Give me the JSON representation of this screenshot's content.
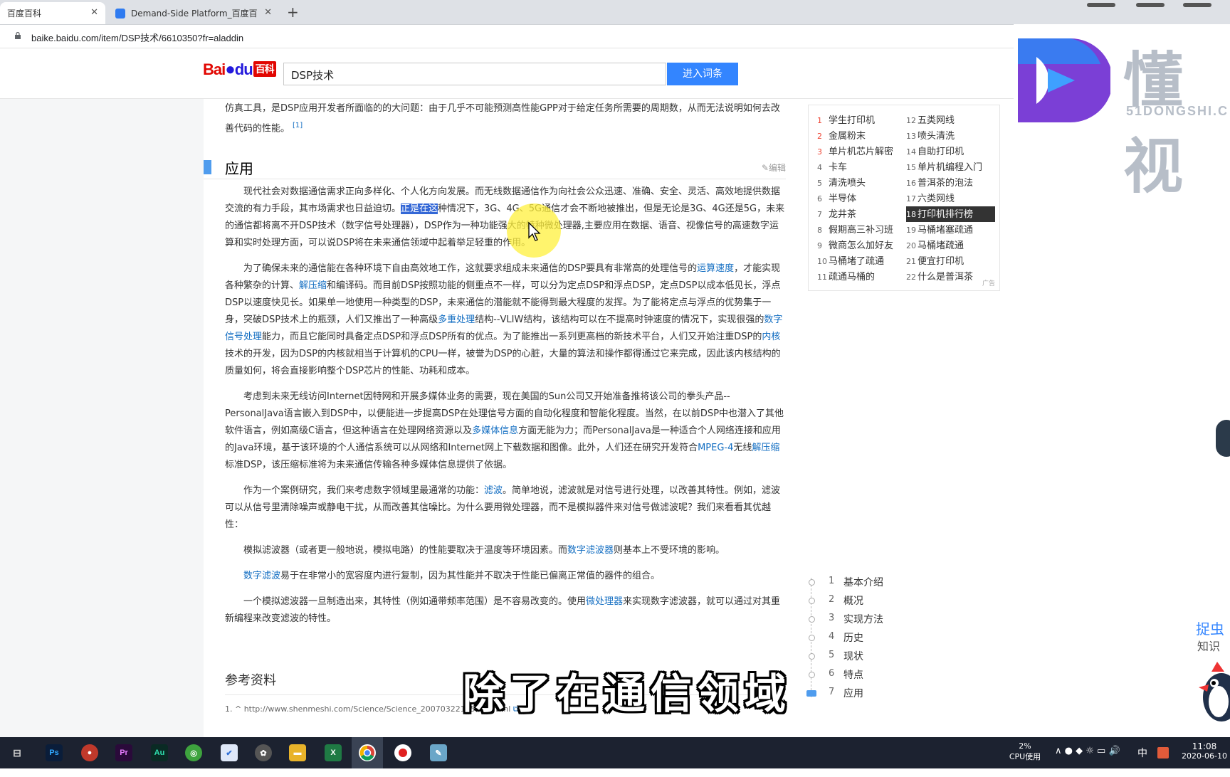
{
  "browser": {
    "tabs": [
      {
        "title": "百度百科",
        "active": true
      },
      {
        "title": "Demand-Side Platform_百度百",
        "active": false
      }
    ],
    "new_tab": "+",
    "url": "baike.baidu.com/item/DSP技术/6610350?fr=aladdin"
  },
  "header": {
    "logo_bai": "Bai",
    "logo_du": "du",
    "logo_baike": "百科",
    "search_value": "DSP技术",
    "search_button": "进入词条"
  },
  "article": {
    "intro": "仿真工具，是DSP应用开发者所面临的的大问题：由于几乎不可能预测高性能GPP对于给定任务所需要的周期数，从而无法说明如何去改善代码的性能。",
    "intro_ref": "[1]",
    "section_title": "应用",
    "edit_label": "编辑",
    "p1": {
      "a": "现代社会对数据通信需求正向多样化、个人化方向发展。而无线数据通信作为向社会公众迅速、准确、安全、灵活、高效地提供数据交流的有力手段，其市场需求也日益迫切。",
      "sel": "正是在这",
      "b": "种情况下，3G、4G、5G通信才会不断地被推出，但是无论是3G、4G还是5G，未来的通信都将离不开DSP技术（数字信号处理器），DSP作为一种功能强大的特种微处理器,主要应用在数据、语音、视像信号的高速数字运算和实时处理方面，可以说DSP将在未来通信领域中起着举足轻重的作用。"
    },
    "p2": {
      "a": "为了确保未来的通信能在各种环境下自由高效地工作，这就要求组成未来通信的DSP要具有非常高的处理信号的",
      "l1": "运算速度",
      "b": "，才能实现各种繁杂的计算、",
      "l2": "解压缩",
      "c": "和编译码。而目前DSP按照功能的侧重点不一样，可以分为定点DSP和浮点DSP，定点DSP以成本低见长，浮点DSP以速度快见长。如果单一地使用一种类型的DSP，未来通信的潜能就不能得到最大程度的发挥。为了能将定点与浮点的优势集于一身，突破DSP技术上的瓶颈，人们又推出了一种高级",
      "l3": "多重处理",
      "d": "结构--VLIW结构，该结构可以在不提高时钟速度的情况下，实现很强的",
      "l4": "数字信号处理",
      "e": "能力，而且它能同时具备定点DSP和浮点DSP所有的优点。为了能推出一系列更高档的新技术平台，人们又开始注重DSP的",
      "l5": "内核",
      "f": "技术的开发，因为DSP的内核就相当于计算机的CPU一样，被誉为DSP的心脏，大量的算法和操作都得通过它来完成，因此该内核结构的质量如何，将会直接影响整个DSP芯片的性能、功耗和成本。"
    },
    "p3": {
      "a": "考虑到未来无线访问Internet因特网和开展多媒体业务的需要，现在美国的Sun公司又开始准备推将该公司的拳头产品--PersonalJava语言嵌入到DSP中，以便能进一步提高DSP在处理信号方面的自动化程度和智能化程度。当然，在以前DSP中也潜入了其他软件语言，例如高级C语言，但这种语言在处理网络资源以及",
      "l1": "多媒体信息",
      "b": "方面无能为力；而PersonalJava是一种适合个人网络连接和应用的Java环境，基于该环境的个人通信系统可以从网络和Internet网上下载数据和图像。此外，人们还在研究开发符合",
      "l2": "MPEG-4",
      "c": "无线",
      "l3": "解压缩",
      "d": "标准DSP，该压缩标准将为未来通信传输各种多媒体信息提供了依据。"
    },
    "p4": {
      "a": "作为一个案例研究，我们来考虑数字领域里最通常的功能：",
      "l1": "滤波",
      "b": "。简单地说，滤波就是对信号进行处理，以改善其特性。例如，滤波可以从信号里清除噪声或静电干扰，从而改善其信噪比。为什么要用微处理器，而不是模拟器件来对信号做滤波呢？我们来看看其优越性："
    },
    "p5": {
      "a": "模拟滤波器（或者更一般地说，模拟电路）的性能要取决于温度等环境因素。而",
      "l1": "数字滤波器",
      "b": "则基本上不受环境的影响。"
    },
    "p6": {
      "l1": "数字滤波",
      "a": "易于在非常小的宽容度内进行复制，因为其性能并不取决于性能已偏离正常值的器件的组合。"
    },
    "p7": {
      "a": "一个模拟滤波器一旦制造出来，其特性（例如通带频率范围）是不容易改变的。使用",
      "l1": "微处理器",
      "b": "来实现数字滤波器，就可以通过对其重新编程来改变滤波的特性。"
    },
    "refs_title": "参考资料",
    "ref1": "1. ^ http://www.shenmeshi.com/Science/Science_20070322165927.html"
  },
  "hot_list": {
    "left": [
      {
        "n": "1",
        "t": "学生打印机"
      },
      {
        "n": "2",
        "t": "金属粉末"
      },
      {
        "n": "3",
        "t": "单片机芯片解密"
      },
      {
        "n": "4",
        "t": "卡车"
      },
      {
        "n": "5",
        "t": "清洗喷头"
      },
      {
        "n": "6",
        "t": "半导体"
      },
      {
        "n": "7",
        "t": "龙井茶"
      },
      {
        "n": "8",
        "t": "假期高三补习班"
      },
      {
        "n": "9",
        "t": "微商怎么加好友"
      },
      {
        "n": "10",
        "t": "马桶堵了疏通"
      },
      {
        "n": "11",
        "t": "疏通马桶的"
      }
    ],
    "right": [
      {
        "n": "12",
        "t": "五类网线"
      },
      {
        "n": "13",
        "t": "喷头清洗"
      },
      {
        "n": "14",
        "t": "自助打印机"
      },
      {
        "n": "15",
        "t": "单片机编程入门"
      },
      {
        "n": "16",
        "t": "普洱茶的泡法"
      },
      {
        "n": "17",
        "t": "六类网线"
      },
      {
        "n": "18",
        "t": "打印机排行榜"
      },
      {
        "n": "19",
        "t": "马桶堵塞疏通"
      },
      {
        "n": "20",
        "t": "马桶堵疏通"
      },
      {
        "n": "21",
        "t": "便宜打印机"
      },
      {
        "n": "22",
        "t": "什么是普洱茶"
      }
    ],
    "ad_label": "广告"
  },
  "catalog": [
    {
      "n": "1",
      "t": "基本介绍"
    },
    {
      "n": "2",
      "t": "概况"
    },
    {
      "n": "3",
      "t": "实现方法"
    },
    {
      "n": "4",
      "t": "历史"
    },
    {
      "n": "5",
      "t": "现状"
    },
    {
      "n": "6",
      "t": "特点"
    },
    {
      "n": "7",
      "t": "应用"
    }
  ],
  "overlay": {
    "watermark_cn": "懂视",
    "watermark_en": "51DONGSHI.C",
    "side_title": "捉虫",
    "side_sub": "知识",
    "subtitle": "除了在通信领域"
  },
  "taskbar": {
    "cpu_pct": "2%",
    "cpu_label": "CPU使用",
    "ime": "中",
    "time": "11:08",
    "date": "2020-06-10"
  }
}
